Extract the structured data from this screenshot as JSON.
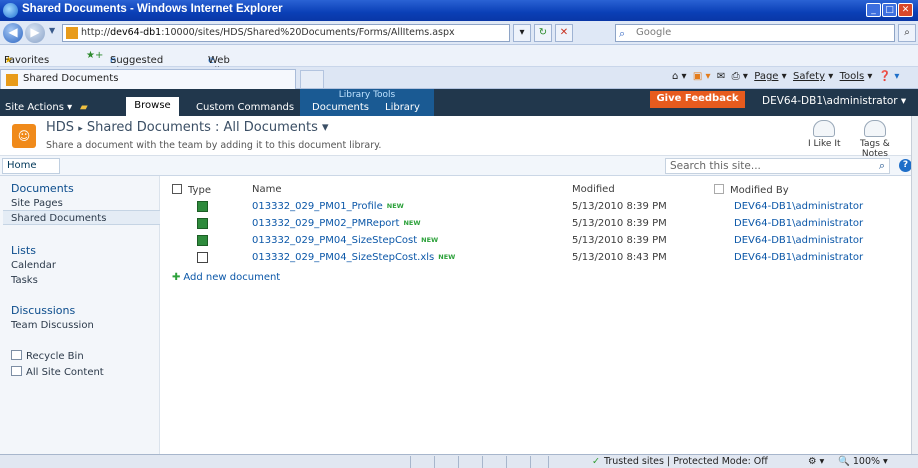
{
  "window": {
    "title": "Shared Documents - Windows Internet Explorer",
    "url_prefix": "http://",
    "url_host": "dev64-db1",
    "url_rest": ":10000/sites/HDS/Shared%20Documents/Forms/AllItems.aspx",
    "search_placeholder": "Google"
  },
  "favorites_bar": {
    "favorites_label": "Favorites",
    "suggested_sites": "Suggested Sites ▾",
    "web_slice_gallery": "Web Slice Gallery ▾"
  },
  "tabs": [
    {
      "label": "Shared Documents"
    }
  ],
  "command_bar": {
    "page": "Page",
    "safety": "Safety",
    "tools": "Tools"
  },
  "ribbon": {
    "site_actions": "Site Actions ▾",
    "browse": "Browse",
    "custom_commands": "Custom Commands",
    "library_tools": "Library Tools",
    "documents": "Documents",
    "library": "Library",
    "give_feedback": "Give Feedback",
    "user": "DEV64-DB1\\administrator ▾"
  },
  "page_header": {
    "site": "HDS",
    "separator": "▸",
    "list": "Shared Documents",
    "view": ": All Documents ▾",
    "description": "Share a document with the team by adding it to this document library.",
    "i_like_it": "I Like It",
    "tags_notes_1": "Tags &",
    "tags_notes_2": "Notes"
  },
  "top_nav": {
    "home": "Home",
    "search_placeholder": "Search this site..."
  },
  "quick_launch": {
    "documents_heading": "Documents",
    "site_pages": "Site Pages",
    "shared_documents": "Shared Documents",
    "lists_heading": "Lists",
    "calendar": "Calendar",
    "tasks": "Tasks",
    "discussions_heading": "Discussions",
    "team_discussion": "Team Discussion",
    "recycle_bin": "Recycle Bin",
    "all_site_content": "All Site Content"
  },
  "doc_list": {
    "columns": {
      "type": "Type",
      "name": "Name",
      "modified": "Modified",
      "modified_by": "Modified By"
    },
    "new_badge": "NEW",
    "rows": [
      {
        "name": "013332_029_PM01_Profile",
        "modified": "5/13/2010 8:39 PM",
        "modified_by": "DEV64-DB1\\administrator"
      },
      {
        "name": "013332_029_PM02_PMReport",
        "modified": "5/13/2010 8:39 PM",
        "modified_by": "DEV64-DB1\\administrator"
      },
      {
        "name": "013332_029_PM04_SizeStepCost",
        "modified": "5/13/2010 8:39 PM",
        "modified_by": "DEV64-DB1\\administrator"
      },
      {
        "name": "013332_029_PM04_SizeStepCost.xls",
        "modified": "5/13/2010 8:43 PM",
        "modified_by": "DEV64-DB1\\administrator"
      }
    ],
    "add_new": "Add new document"
  },
  "status_bar": {
    "zone": "Trusted sites | Protected Mode: Off",
    "zoom": "100%"
  }
}
